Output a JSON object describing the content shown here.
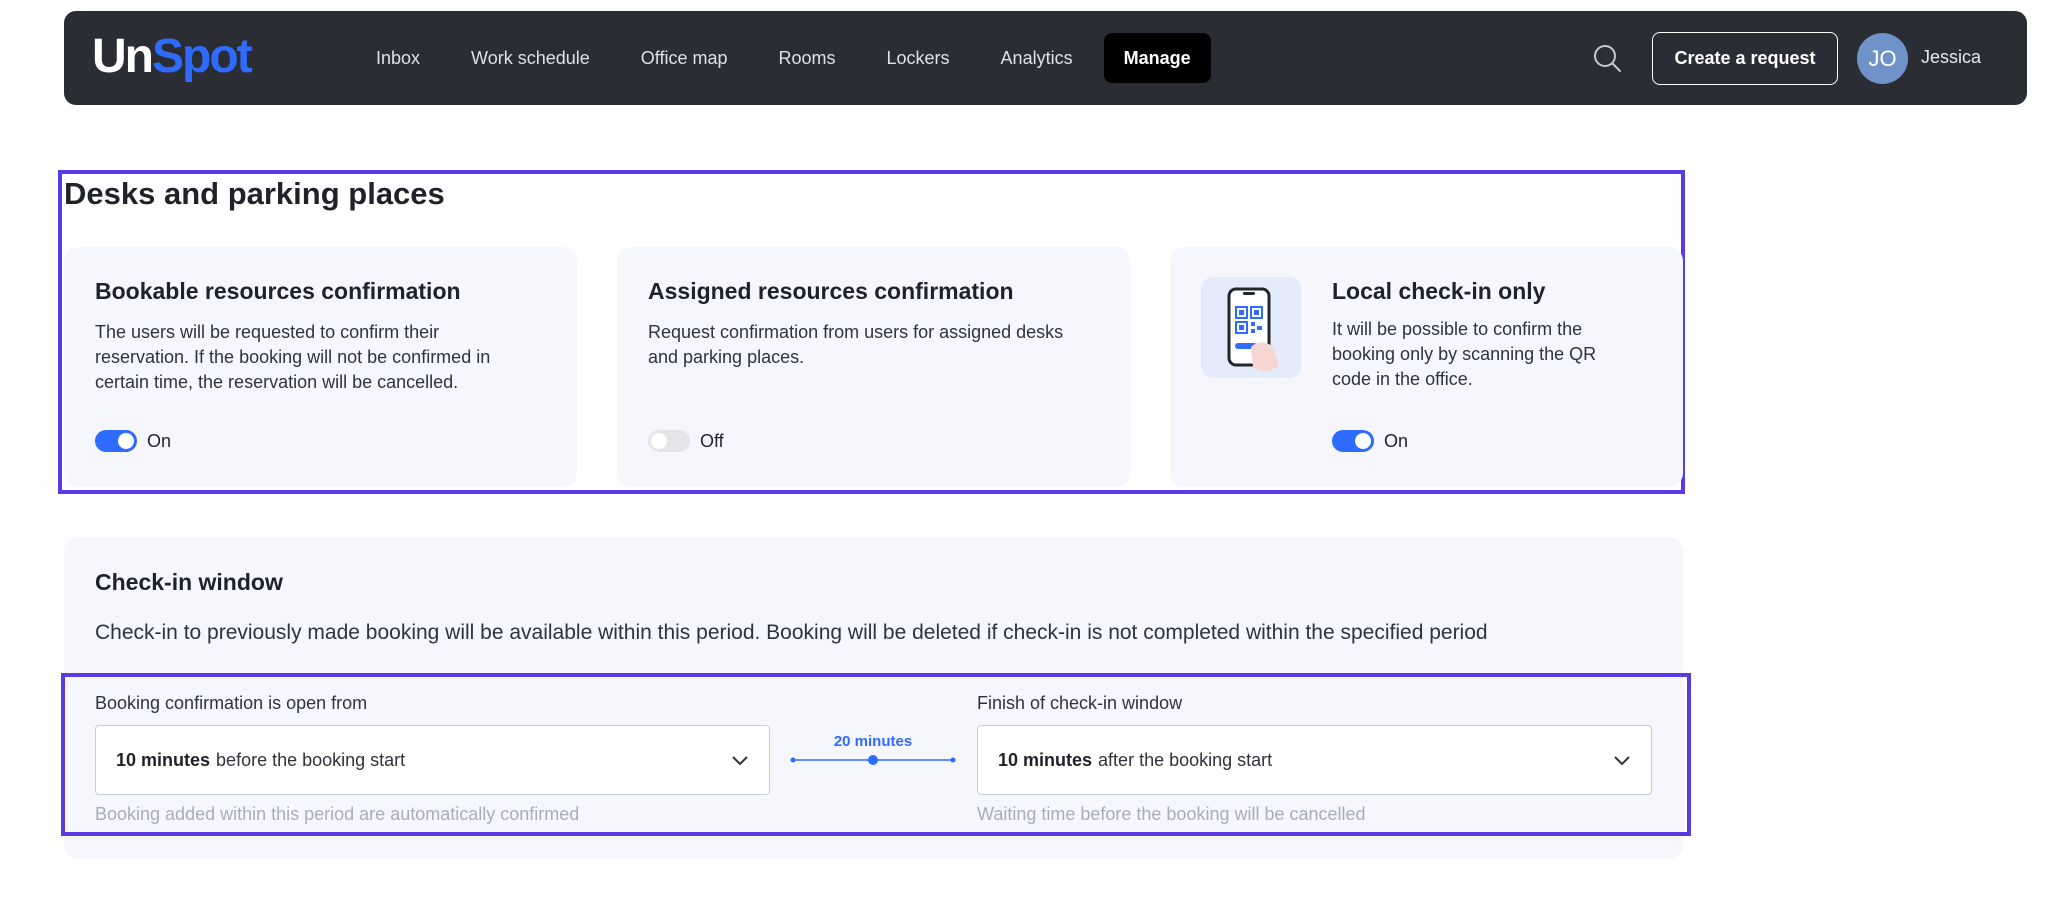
{
  "app": {
    "logo_primary": "Un",
    "logo_accent": "Spot",
    "accent_color": "#2f6bff",
    "frame_color": "#5b3ae6"
  },
  "nav": {
    "items": [
      {
        "label": "Inbox",
        "active": false
      },
      {
        "label": "Work schedule",
        "active": false
      },
      {
        "label": "Office map",
        "active": false
      },
      {
        "label": "Rooms",
        "active": false
      },
      {
        "label": "Lockers",
        "active": false
      },
      {
        "label": "Analytics",
        "active": false
      },
      {
        "label": "Manage",
        "active": true
      }
    ],
    "search_icon": "search-icon",
    "create_label": "Create a request",
    "avatar_initials": "JO",
    "user_name": "Jessica"
  },
  "section": {
    "title": "Desks and parking places"
  },
  "cards": [
    {
      "title": "Bookable resources confirmation",
      "desc_lines": [
        "The users will be requested to confirm their",
        "reservation. If the booking will not be confirmed in",
        "certain time, the reservation will be cancelled."
      ],
      "toggle_state": "on",
      "toggle_label": "On"
    },
    {
      "title": "Assigned resources confirmation",
      "desc_lines": [
        "Request confirmation from users for assigned desks",
        "and parking places."
      ],
      "toggle_state": "off",
      "toggle_label": "Off"
    },
    {
      "title": "Local check-in only",
      "desc_lines": [
        "It will be possible to confirm the",
        "booking only by scanning the QR",
        "code in the office."
      ],
      "icon": "phone-qr-icon",
      "toggle_state": "on",
      "toggle_label": "On"
    }
  ],
  "checkin": {
    "title": "Check-in window",
    "description": "Check-in to previously made booking will be available within this period. Booking will be deleted if check-in is not completed within the specified period",
    "from": {
      "label": "Booking confirmation is open from",
      "value_bold": "10 minutes",
      "value_rest": "before the booking start",
      "hint": "Booking added within this period are automatically confirmed"
    },
    "duration_label": "20 minutes",
    "to": {
      "label": "Finish of check-in window",
      "value_bold": "10 minutes",
      "value_rest": "after the booking start",
      "hint": "Waiting time before the booking will be cancelled"
    }
  }
}
